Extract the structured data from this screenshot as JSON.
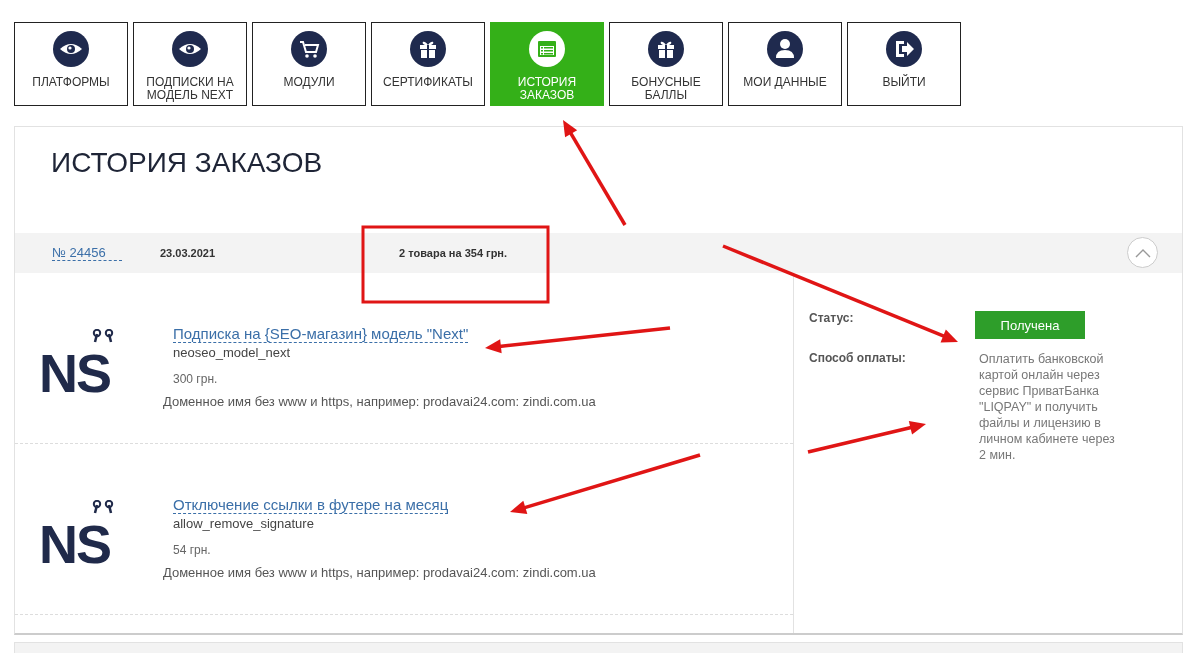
{
  "tabs": [
    {
      "label": "ПЛАТФОРМЫ",
      "selected": false
    },
    {
      "label": "ПОДПИСКИ НА МОДЕЛЬ NEXT",
      "selected": false
    },
    {
      "label": "МОДУЛИ",
      "selected": false
    },
    {
      "label": "СЕРТИФИКАТЫ",
      "selected": false
    },
    {
      "label": "ИСТОРИЯ ЗАКАЗОВ",
      "selected": true
    },
    {
      "label": "БОНУСНЫЕ БАЛЛЫ",
      "selected": false
    },
    {
      "label": "МОИ ДАННЫЕ",
      "selected": false
    },
    {
      "label": "ВЫЙТИ",
      "selected": false
    }
  ],
  "page_title": "ИСТОРИЯ ЗАКАЗОВ",
  "order": {
    "number": "№ 24456",
    "date": "23.03.2021",
    "summary": "2 товара на 354 грн.",
    "expanded": true,
    "items": [
      {
        "logo": "NS",
        "name": "Подписка на {SEO-магазин} модель \"Next\"",
        "code": "neoseo_model_next",
        "price": "300 грн.",
        "note": "Доменное имя без www и https, например: prodavai24.com: zindi.com.ua"
      },
      {
        "logo": "NS",
        "name": "Отключение ссылки в футере на месяц",
        "code": "allow_remove_signature",
        "price": "54 грн.",
        "note": "Доменное имя без www и https, например: prodavai24.com: zindi.com.ua"
      }
    ],
    "status_label": "Статус:",
    "status": "Получена",
    "payment_label": "Способ оплаты:",
    "payment": "Оплатить банковской картой онлайн через сервис ПриватБанка \"LIQPAY\" и получить файлы и лицензию в личном кабинете через 2 мин."
  }
}
